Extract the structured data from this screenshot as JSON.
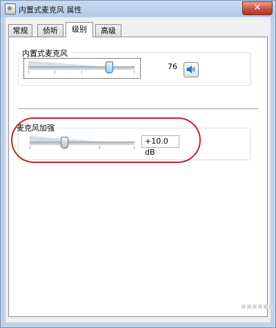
{
  "window": {
    "title": "内置式麦克风 属性",
    "close_label": "✕"
  },
  "tabs": [
    {
      "label": "常规",
      "active": false
    },
    {
      "label": "侦听",
      "active": false
    },
    {
      "label": "级别",
      "active": true
    },
    {
      "label": "高级",
      "active": false
    }
  ],
  "microphone": {
    "label": "内置式麦克风",
    "value": "76",
    "slider_level": 0.76,
    "mute_icon": "speaker-icon"
  },
  "boost": {
    "label": "麦克风加强",
    "value": "+10.0 dB",
    "slider_level": 0.33
  },
  "colors": {
    "highlight": "#cc1f26",
    "title_bar": "#bfd3ea",
    "slider_thumb": "#9fcfec"
  }
}
